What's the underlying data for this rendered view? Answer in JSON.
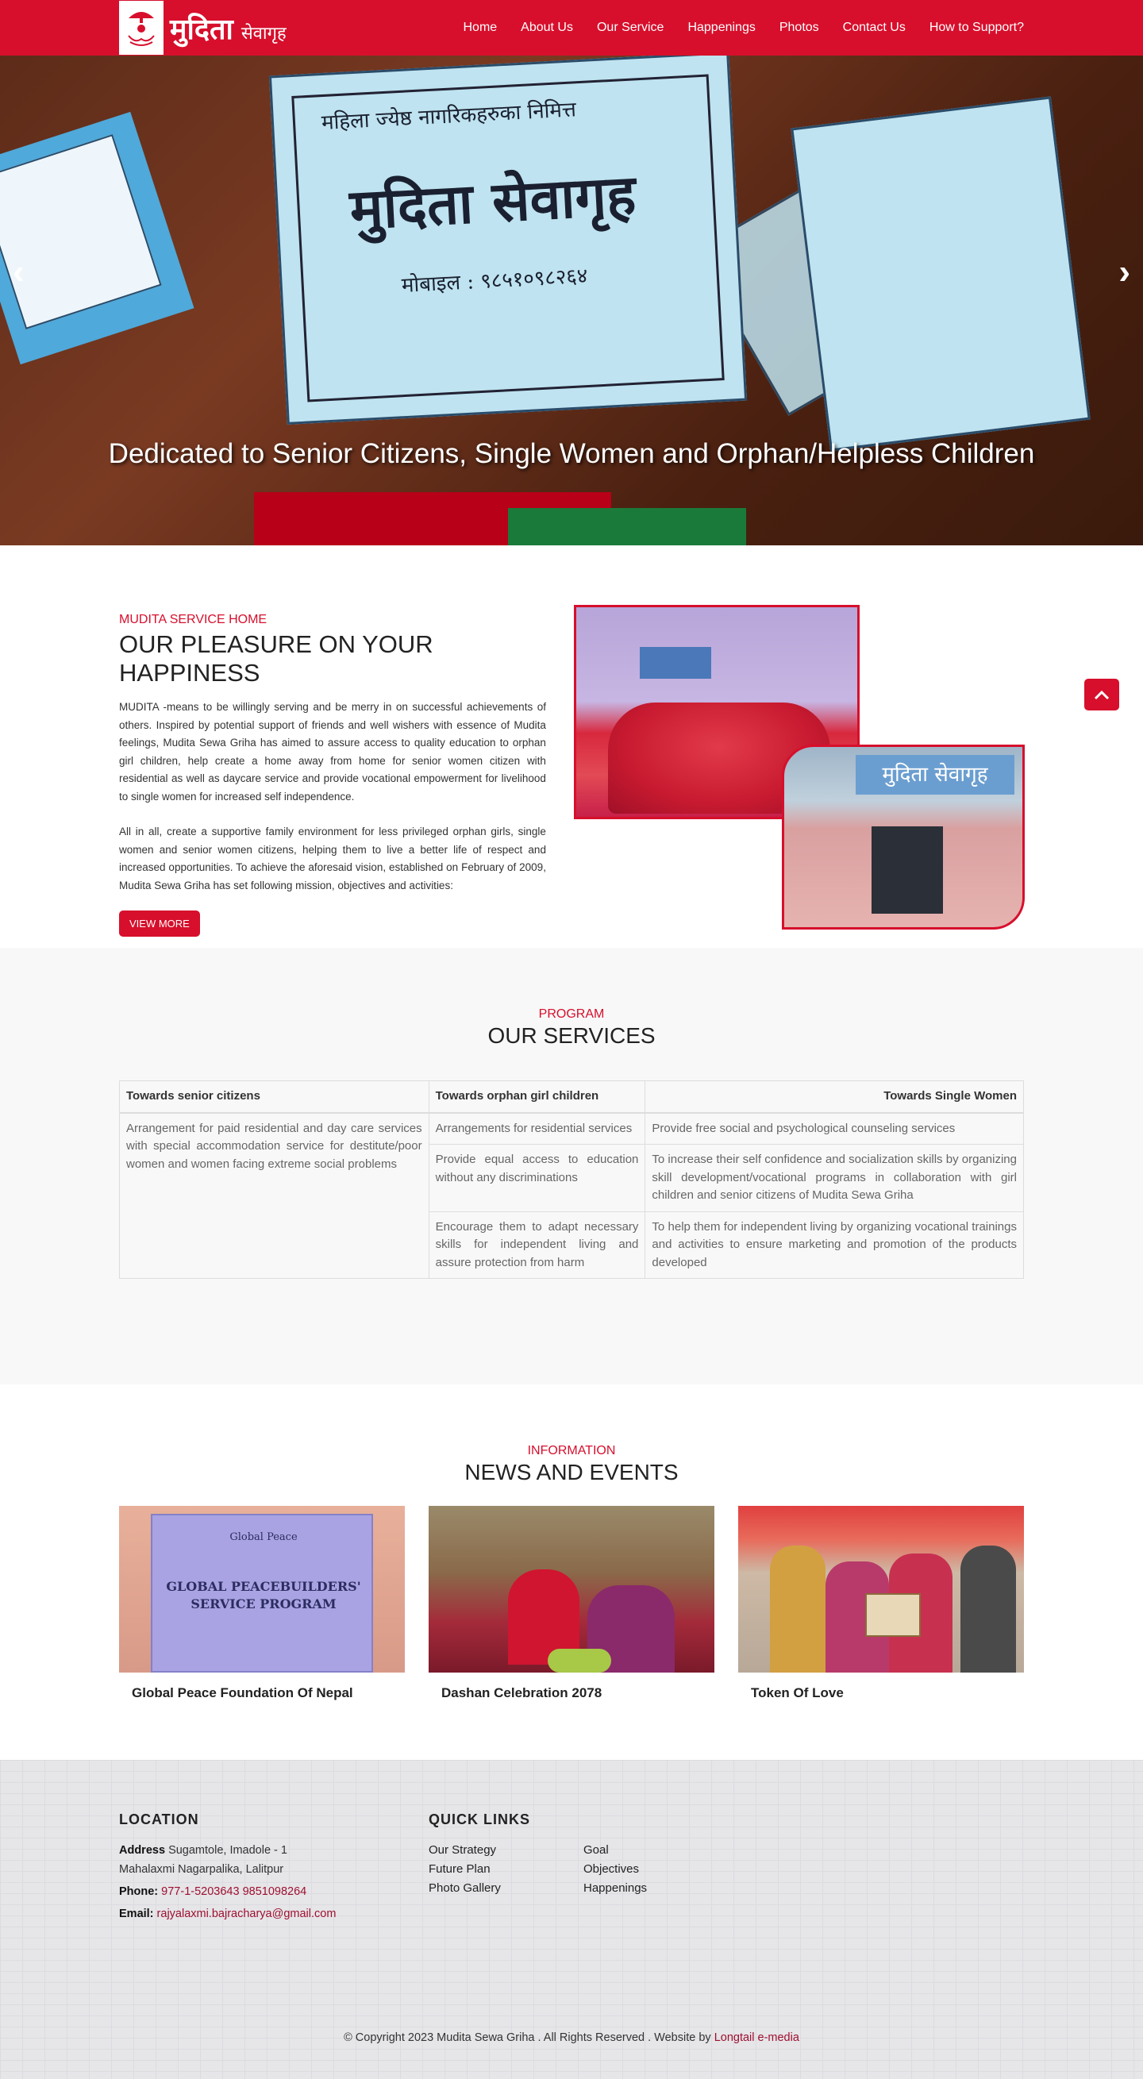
{
  "brand": {
    "logo_main": "मुदिता",
    "logo_sub": "सेवागृह"
  },
  "nav": {
    "items": [
      "Home",
      "About Us",
      "Our Service",
      "Happenings",
      "Photos",
      "Contact Us",
      "How to Support?"
    ]
  },
  "hero": {
    "caption": "Dedicated to Senior Citizens, Single Women and Orphan/Helpless Children",
    "card_title": "मुदिता सेवागृह",
    "card_subtitle": "महिला ज्येष्ठ नागरिकहरुका निमित्त",
    "card_line": "मोबाइल : ९८५१०९८२६४",
    "prev_icon": "‹",
    "next_icon": "›"
  },
  "about": {
    "kicker": "MUDITA SERVICE HOME",
    "title": "OUR PLEASURE ON YOUR HAPPINESS",
    "para1": "MUDITA -means to be willingly serving and be merry in on successful achievements of others. Inspired by potential support of friends and well wishers with essence of Mudita feelings, Mudita Sewa Griha has aimed to assure access to quality education to orphan girl children, help create a home away from home for senior women citizen with residential as well as daycare service and provide vocational empowerment for livelihood to single women for increased self independence.",
    "para2": "All in all, create a supportive family environment for less privileged orphan girls, single women and senior women citizens, helping them to live a better life of respect and increased opportunities. To achieve the aforesaid vision, established on February of 2009, Mudita Sewa Griha has set following mission, objectives and activities:",
    "button": "VIEW MORE",
    "image2_sign": "मुदिता सेवागृह"
  },
  "services": {
    "kicker": "PROGRAM",
    "title": "OUR SERVICES",
    "headers": [
      "Towards senior citizens",
      "Towards orphan girl children",
      "Towards Single Women"
    ],
    "senior": "Arrangement for paid residential and day care services with special accommodation service for destitute/poor women and women facing extreme social problems",
    "orphan": [
      "Arrangements for residential services",
      "Provide equal access to education without any discriminations",
      "Encourage them to adapt necessary skills for independent living and assure protection from harm"
    ],
    "women": [
      "Provide free social and psychological counseling services",
      "To increase their self confidence and socialization skills by organizing skill development/vocational programs in collaboration with girl children and senior citizens of Mudita Sewa Griha",
      "To help them for independent living by organizing vocational trainings and activities to ensure marketing and promotion of the products developed"
    ]
  },
  "news": {
    "kicker": "INFORMATION",
    "title": "NEWS AND EVENTS",
    "items": [
      {
        "title": "Global Peace Foundation Of Nepal",
        "board_line1": "GLOBAL PEACEBUILDERS'",
        "board_line2": "SERVICE PROGRAM",
        "board_brand": "Global Peace"
      },
      {
        "title": "Dashan Celebration 2078"
      },
      {
        "title": "Token Of Love"
      }
    ]
  },
  "footer": {
    "location_title": "LOCATION",
    "address_label": "Address",
    "address_line1": "Sugamtole, Imadole - 1",
    "address_line2": "Mahalaxmi Nagarpalika, Lalitpur",
    "phone_label": "Phone:",
    "phone": "977-1-5203643 9851098264",
    "email_label": "Email:",
    "email": "rajyalaxmi.bajracharya@gmail.com",
    "links_title": "QUICK LINKS",
    "links": [
      "Our Strategy",
      "Goal",
      "Future Plan",
      "Objectives",
      "Photo Gallery",
      "Happenings"
    ],
    "copyright": "© Copyright 2023 Mudita Sewa Griha . All Rights Reserved . Website by",
    "credit": "Longtail e-media"
  },
  "colors": {
    "brand_red": "#d70f2c",
    "footer_bg": "#e6e5e8"
  },
  "icons": {
    "back_to_top": "chevron-up-icon"
  }
}
